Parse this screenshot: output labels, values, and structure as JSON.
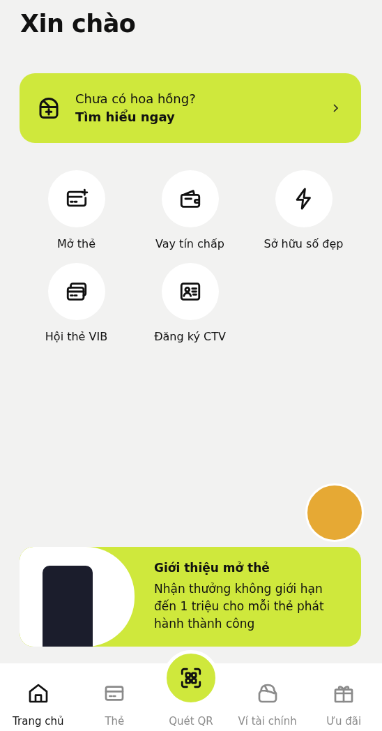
{
  "greeting": "Xin chào",
  "commission_card": {
    "question": "Chưa có hoa hồng?",
    "link": "Tìm hiểu ngay"
  },
  "services": [
    {
      "label": "Mở thẻ"
    },
    {
      "label": "Vay tín chấp"
    },
    {
      "label": "Sở hữu số đẹp"
    },
    {
      "label": "Hội thẻ VIB"
    },
    {
      "label": "Đăng ký CTV"
    }
  ],
  "promo": {
    "title": "Giới thiệu mở thẻ",
    "text": "Nhận thưởng không giới hạn đến 1 triệu cho mỗi thẻ phát hành thành công"
  },
  "bottom_nav": [
    {
      "label": "Trang chủ",
      "kind": "tab",
      "selected": true
    },
    {
      "label": "Thẻ",
      "kind": "tab",
      "selected": false
    },
    {
      "label": "Quét QR",
      "kind": "scan",
      "selected": false
    },
    {
      "label": "Ví tài chính",
      "kind": "tab",
      "selected": false
    },
    {
      "label": "Ưu đãi",
      "kind": "tab",
      "selected": false
    }
  ]
}
